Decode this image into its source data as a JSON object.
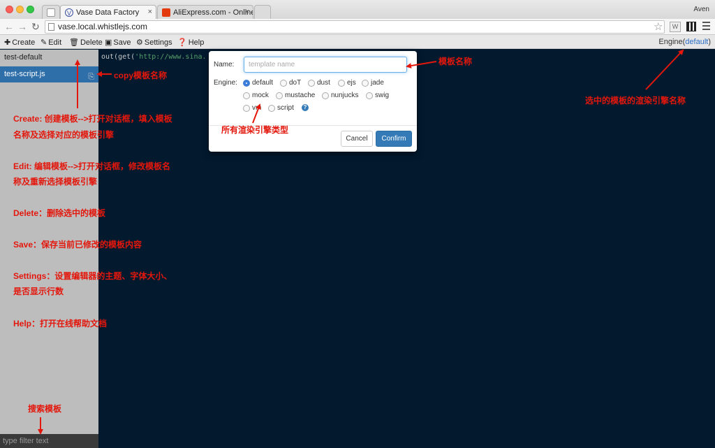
{
  "browser": {
    "tabs": [
      {
        "label": ""
      },
      {
        "label": "Vase Data Factory"
      },
      {
        "label": "AliExpress.com - Online Sh"
      },
      {
        "label": ""
      }
    ],
    "user": "Aven",
    "url": "vase.local.whistlejs.com",
    "extension_w": "W"
  },
  "toolbar": {
    "create": "Create",
    "edit": "Edit",
    "delete": "Delete",
    "save": "Save",
    "settings": "Settings",
    "help": "Help",
    "engine_prefix": "Engine(",
    "engine_value": "default",
    "engine_suffix": ")"
  },
  "sidebar": {
    "items": [
      {
        "label": "test-default"
      },
      {
        "label": "test-script.js"
      }
    ],
    "filter_placeholder": "type filter text"
  },
  "editor": {
    "code_prefix": "out(get(",
    "code_string": "'http://www.sina."
  },
  "modal": {
    "name_label": "Name:",
    "name_placeholder": "template name",
    "engine_label": "Engine:",
    "engines": [
      "default",
      "doT",
      "dust",
      "ejs",
      "jade",
      "mock",
      "mustache",
      "nunjucks",
      "swig",
      "vm",
      "script"
    ],
    "selected_engine": "default",
    "help_glyph": "?",
    "cancel": "Cancel",
    "confirm": "Confirm"
  },
  "annotations": {
    "template_name": "模板名称",
    "copy": "copy模板名称",
    "selected_engine": "选中的模板的渲染引擎名称",
    "all_engines": "所有渲染引擎类型",
    "create_1": "Create: 创建模板-->打开对话框，填入模板",
    "create_2": "名称及选择对应的模板引擎",
    "edit_1": "Edit: 编辑模板-->打开对话框，修改模板名",
    "edit_2": "称及重新选择模板引擎",
    "delete": "Delete：删除选中的模板",
    "save": "Save：保存当前已修改的模板内容",
    "settings_1": "Settings：设置编辑器的主题、字体大小、",
    "settings_2": "是否显示行数",
    "help": "Help：打开在线帮助文档",
    "search": "搜索模板"
  },
  "colors": {
    "annotation": "#e4170c",
    "editor_bg": "#02192e",
    "sidebar_bg": "#bdbdbd",
    "selected_item": "#2e6ea9",
    "confirm_btn": "#337ab7"
  }
}
